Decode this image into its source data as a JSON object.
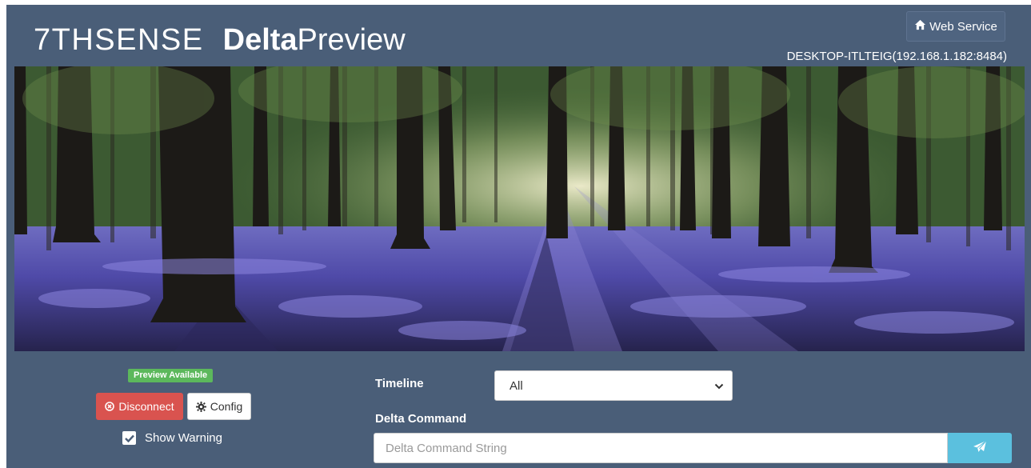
{
  "header": {
    "logo_text": "7THSENSE",
    "app_title_bold": "Delta",
    "app_title_rest": "Preview",
    "web_service_label": "Web Service",
    "web_service_icon": "home-icon",
    "host": "DESKTOP-ITLTEIG(192.168.1.182:8484)"
  },
  "preview": {
    "image_subject": "bluebell forest"
  },
  "status": {
    "badge": "Preview Available",
    "badge_color": "#5cb85c"
  },
  "buttons": {
    "disconnect_label": "Disconnect",
    "disconnect_icon": "times-circle-icon",
    "disconnect_color": "#d9534f",
    "config_label": "Config",
    "config_icon": "gear-icon"
  },
  "show_warning": {
    "label": "Show Warning",
    "checked": true
  },
  "timeline": {
    "label": "Timeline",
    "selected": "All"
  },
  "delta_command": {
    "label": "Delta Command",
    "placeholder": "Delta Command String",
    "value": "",
    "send_icon": "paper-plane-icon",
    "send_color": "#5bc0de"
  },
  "colors": {
    "background": "#4a5e78"
  }
}
